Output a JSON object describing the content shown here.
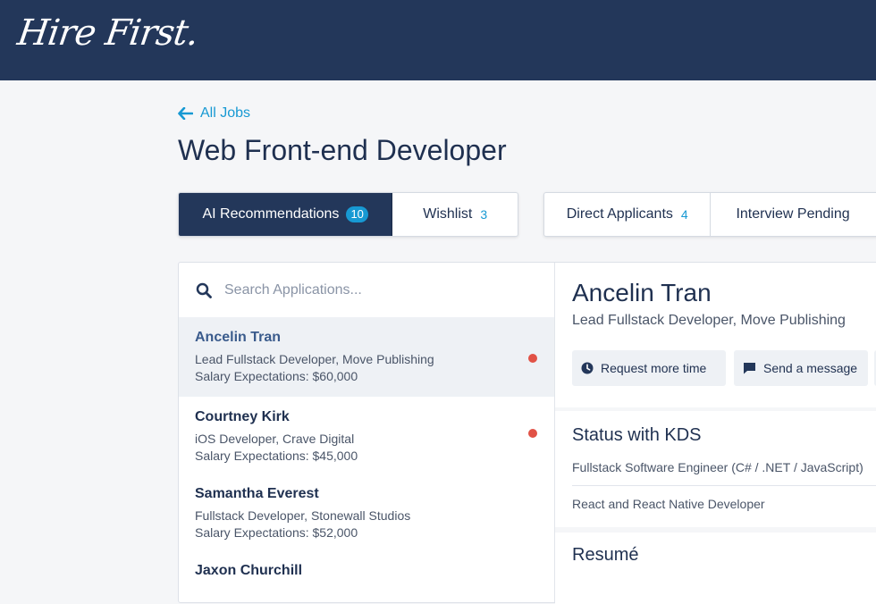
{
  "app": {
    "logo": "Hire First."
  },
  "nav": {
    "back_label": "All Jobs"
  },
  "job": {
    "title": "Web Front-end Developer"
  },
  "tabs": [
    {
      "label": "AI Recommendations",
      "count": "10"
    },
    {
      "label": "Wishlist",
      "count": "3"
    },
    {
      "label": "Direct Applicants",
      "count": "4"
    },
    {
      "label": "Interview Pending"
    }
  ],
  "search": {
    "placeholder": "Search Applications..."
  },
  "applications": [
    {
      "name": "Ancelin Tran",
      "role": "Lead Fullstack Developer, Move Publishing",
      "salary": "Salary Expectations: $60,000",
      "unread": true
    },
    {
      "name": "Courtney Kirk",
      "role": "iOS Developer, Crave Digital",
      "salary": "Salary Expectations: $45,000",
      "unread": true
    },
    {
      "name": "Samantha Everest",
      "role": "Fullstack Developer, Stonewall Studios",
      "salary": "Salary Expectations: $52,000",
      "unread": false
    },
    {
      "name": "Jaxon Churchill"
    }
  ],
  "detail": {
    "name": "Ancelin Tran",
    "role": "Lead Fullstack Developer, Move Publishing",
    "actions": {
      "request_time": "Request more time",
      "send_message": "Send a message"
    },
    "status_title": "Status with KDS",
    "status_items": [
      "Fullstack Software Engineer (C# / .NET / JavaScript)",
      "React and React Native Developer"
    ],
    "resume_title": "Resumé"
  },
  "colors": {
    "navy": "#23375a",
    "accent": "#1799d3",
    "alert": "#e15246"
  },
  "icons": {
    "back": "arrow-left-icon",
    "search": "search-icon",
    "clock": "clock-icon",
    "message": "message-icon"
  }
}
